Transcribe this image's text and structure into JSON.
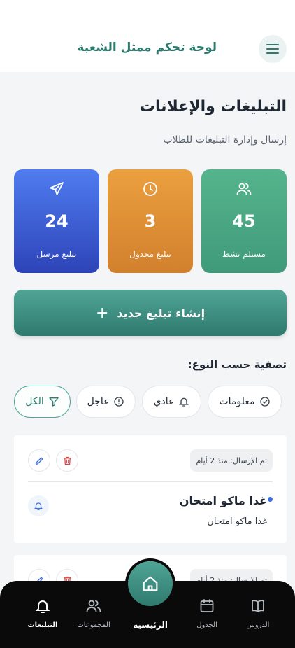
{
  "header": {
    "title": "لوحة تحكم ممثل الشعبة",
    "menu_icon": "menu-icon"
  },
  "page": {
    "title": "التبليغات والإعلانات",
    "subtitle": "إرسال وإدارة التبليغات للطلاب"
  },
  "stats": {
    "active": {
      "value": "45",
      "label": "مستلم نشط",
      "icon": "users-icon",
      "color": "#4aa882"
    },
    "scheduled": {
      "value": "3",
      "label": "تبليغ مجدول",
      "icon": "clock-icon",
      "color": "#e0923a"
    },
    "sent": {
      "value": "24",
      "label": "تبليغ مرسل",
      "icon": "send-icon",
      "color": "#3b5fd8"
    }
  },
  "create_button": {
    "label": "إنشاء تبليغ جديد",
    "icon": "plus-icon"
  },
  "filters": {
    "label": "تصفية حسب النوع:",
    "info": "معلومات",
    "normal": "عادي",
    "urgent": "عاجل",
    "all": "الكل"
  },
  "notifications": [
    {
      "sent_badge": "تم الإرسال: منذ 2 أيام",
      "title": "غدا ماكو امتحان",
      "body": "غدا ماكو امتحان"
    },
    {
      "sent_badge": "تم الإرسال: منذ 2 أيام"
    }
  ],
  "bottom_nav": {
    "lessons": "الدروس",
    "schedule": "الجدول",
    "home": "الرئيسية",
    "groups": "المجموعات",
    "notifications": "التبليغات"
  },
  "colors": {
    "accent": "#2f7a6e",
    "background": "#f3f5f7",
    "nav": "#0a0a0a",
    "delete": "#d64545",
    "edit": "#3b6fe0"
  }
}
